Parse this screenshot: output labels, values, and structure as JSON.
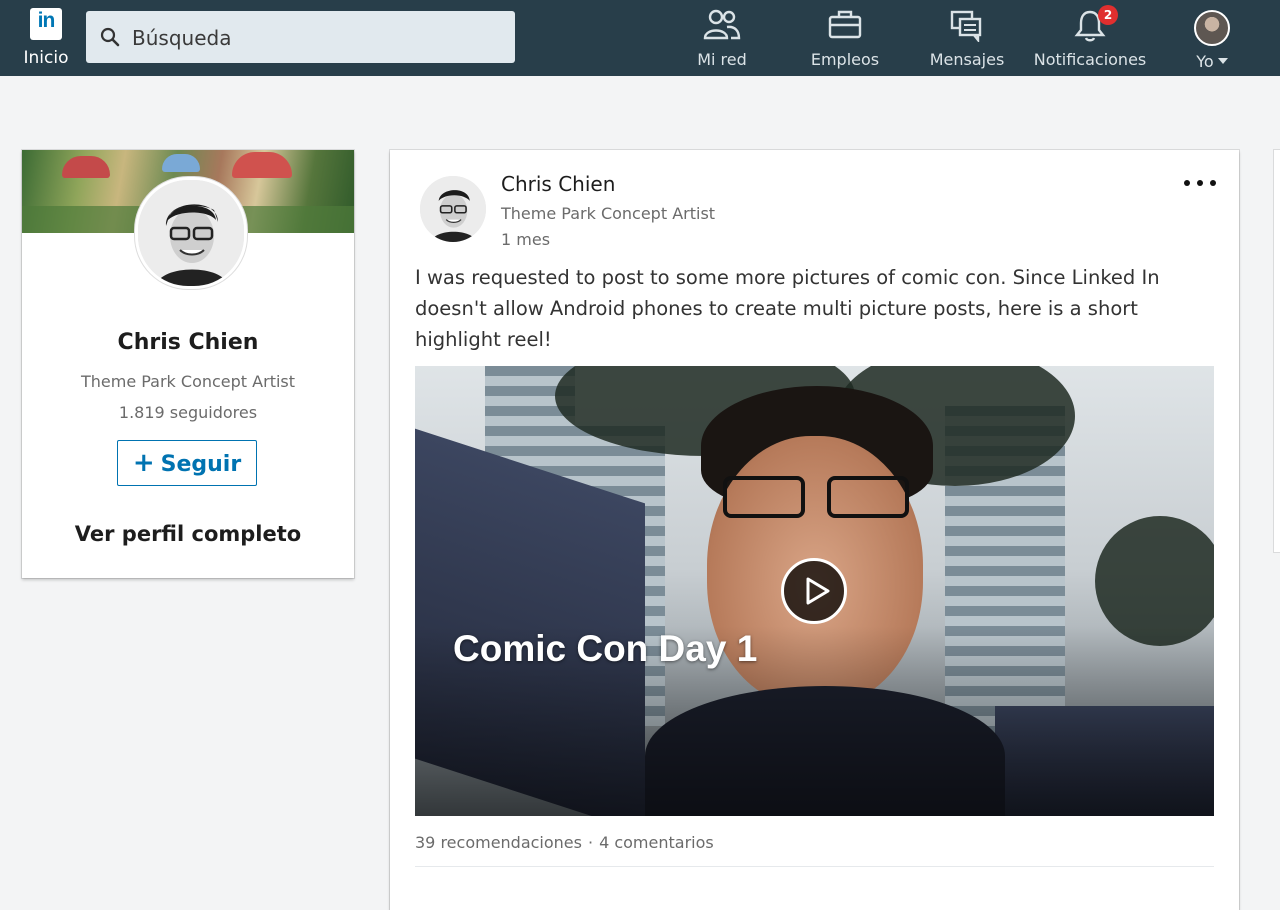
{
  "nav": {
    "home_label": "Inicio",
    "logo_text": "in",
    "search_placeholder": "Búsqueda",
    "network_label": "Mi red",
    "jobs_label": "Empleos",
    "messages_label": "Mensajes",
    "notifications_label": "Notificaciones",
    "notifications_count": "2",
    "me_label": "Yo"
  },
  "profile_card": {
    "name": "Chris Chien",
    "title": "Theme Park Concept Artist",
    "followers": "1.819 seguidores",
    "follow_icon": "+",
    "follow_label": "Seguir",
    "view_profile_label": "Ver perfil completo"
  },
  "post": {
    "author": "Chris Chien",
    "author_title": "Theme Park Concept Artist",
    "time": "1 mes",
    "text": "I was requested to post to some more pictures of comic con. Since Linked In doesn't allow Android phones to create multi picture posts, here is a short highlight reel!",
    "video_title": "Comic Con Day 1",
    "likes": "39 recomendaciones",
    "separator": "·",
    "comments": "4 comentarios"
  },
  "colors": {
    "topbar": "#283e4a",
    "accent": "#0073b1",
    "badge": "#e02f2f",
    "background": "#f3f4f5"
  },
  "icons": [
    "linkedin-logo-icon",
    "search-icon",
    "network-icon",
    "briefcase-icon",
    "messages-icon",
    "bell-icon",
    "play-icon",
    "more-options-icon"
  ]
}
